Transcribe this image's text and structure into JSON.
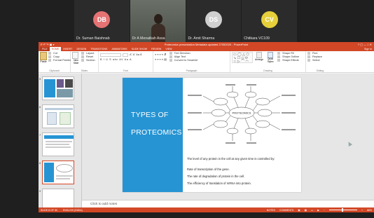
{
  "participants": [
    {
      "initials": "DB",
      "name": "Dr. Suman Baishnab",
      "color": "#e57373",
      "video": false
    },
    {
      "initials": "",
      "name": "Dr A Menatkah Assa",
      "color": "#000000",
      "video": true
    },
    {
      "initials": "DS",
      "name": "Dr. Amit Sharma",
      "color": "#cfcfcf",
      "video": false
    },
    {
      "initials": "CV",
      "name": "Chitkara VC109",
      "color": "#e6cf3a",
      "video": false
    }
  ],
  "powerpoint": {
    "title": "Proteomics presentation Metadata updated 27052020 - PowerPoint",
    "quick_access": "P  ↶  ↷  ▣  ▾",
    "window_controls": "?  ▢  —  □  ✕",
    "tabs": [
      "FILE",
      "HOME",
      "INSERT",
      "DESIGN",
      "TRANSITIONS",
      "ANIMATIONS",
      "SLIDE SHOW",
      "REVIEW",
      "VIEW"
    ],
    "active_tab": "HOME",
    "sign_in": "Sign in",
    "ribbon": {
      "clipboard": {
        "label": "Clipboard",
        "paste": "Paste",
        "cut": "Cut",
        "copy": "Copy",
        "format_painter": "Format Painter"
      },
      "slides": {
        "label": "Slides",
        "new_slide": "New Slide",
        "layout": "Layout",
        "reset": "Reset",
        "section": "Section"
      },
      "font": {
        "label": "Font",
        "row1": "Aˆ Aˇ  Aa  Â",
        "row2": "B  I  U  S  abc  AV  Aa  A"
      },
      "paragraph": {
        "label": "Paragraph",
        "row1": "≡ ≡ ≡ ≡  ⇵",
        "row2": "≡ ≡ ≡ ≡  ▤",
        "text_direction": "Text Direction",
        "align_text": "Align Text",
        "smartart": "Convert to SmartArt"
      },
      "drawing": {
        "label": "Drawing",
        "arrange": "Arrange",
        "quick_styles": "Quick Styles",
        "shape_fill": "Shape Fill",
        "shape_outline": "Shape Outline",
        "shape_effects": "Shape Effects"
      },
      "editing": {
        "label": "Editing",
        "find": "Find",
        "replace": "Replace",
        "select": "Select"
      }
    },
    "thumbnails": [
      {
        "number": "5",
        "selected": false
      },
      {
        "number": "6",
        "selected": false
      },
      {
        "number": "7",
        "selected": false
      },
      {
        "number": "8",
        "selected": true
      },
      {
        "number": "9",
        "selected": false
      }
    ],
    "slide": {
      "title_line1": "TYPES OF",
      "title_line2": "PROTEOMICS",
      "center_label": "PROTEOMICS",
      "bullets": [
        "The level of any protein in the cell at any given time is controlled by:",
        "Rate of transcription of the gene.",
        "The rate of degradation of protein in the cell.",
        "The efficiency of translation of mRNA into protein."
      ]
    },
    "notes_placeholder": "Click to add notes",
    "status": {
      "slide_info": "SLIDE 8 OF 30",
      "language": "ENGLISH (INDIA)",
      "notes": "NOTES",
      "comments": "COMMENTS",
      "zoom": "66%"
    },
    "colors": {
      "accent": "#d24726",
      "slide_title_bg": "#2694d3"
    }
  }
}
